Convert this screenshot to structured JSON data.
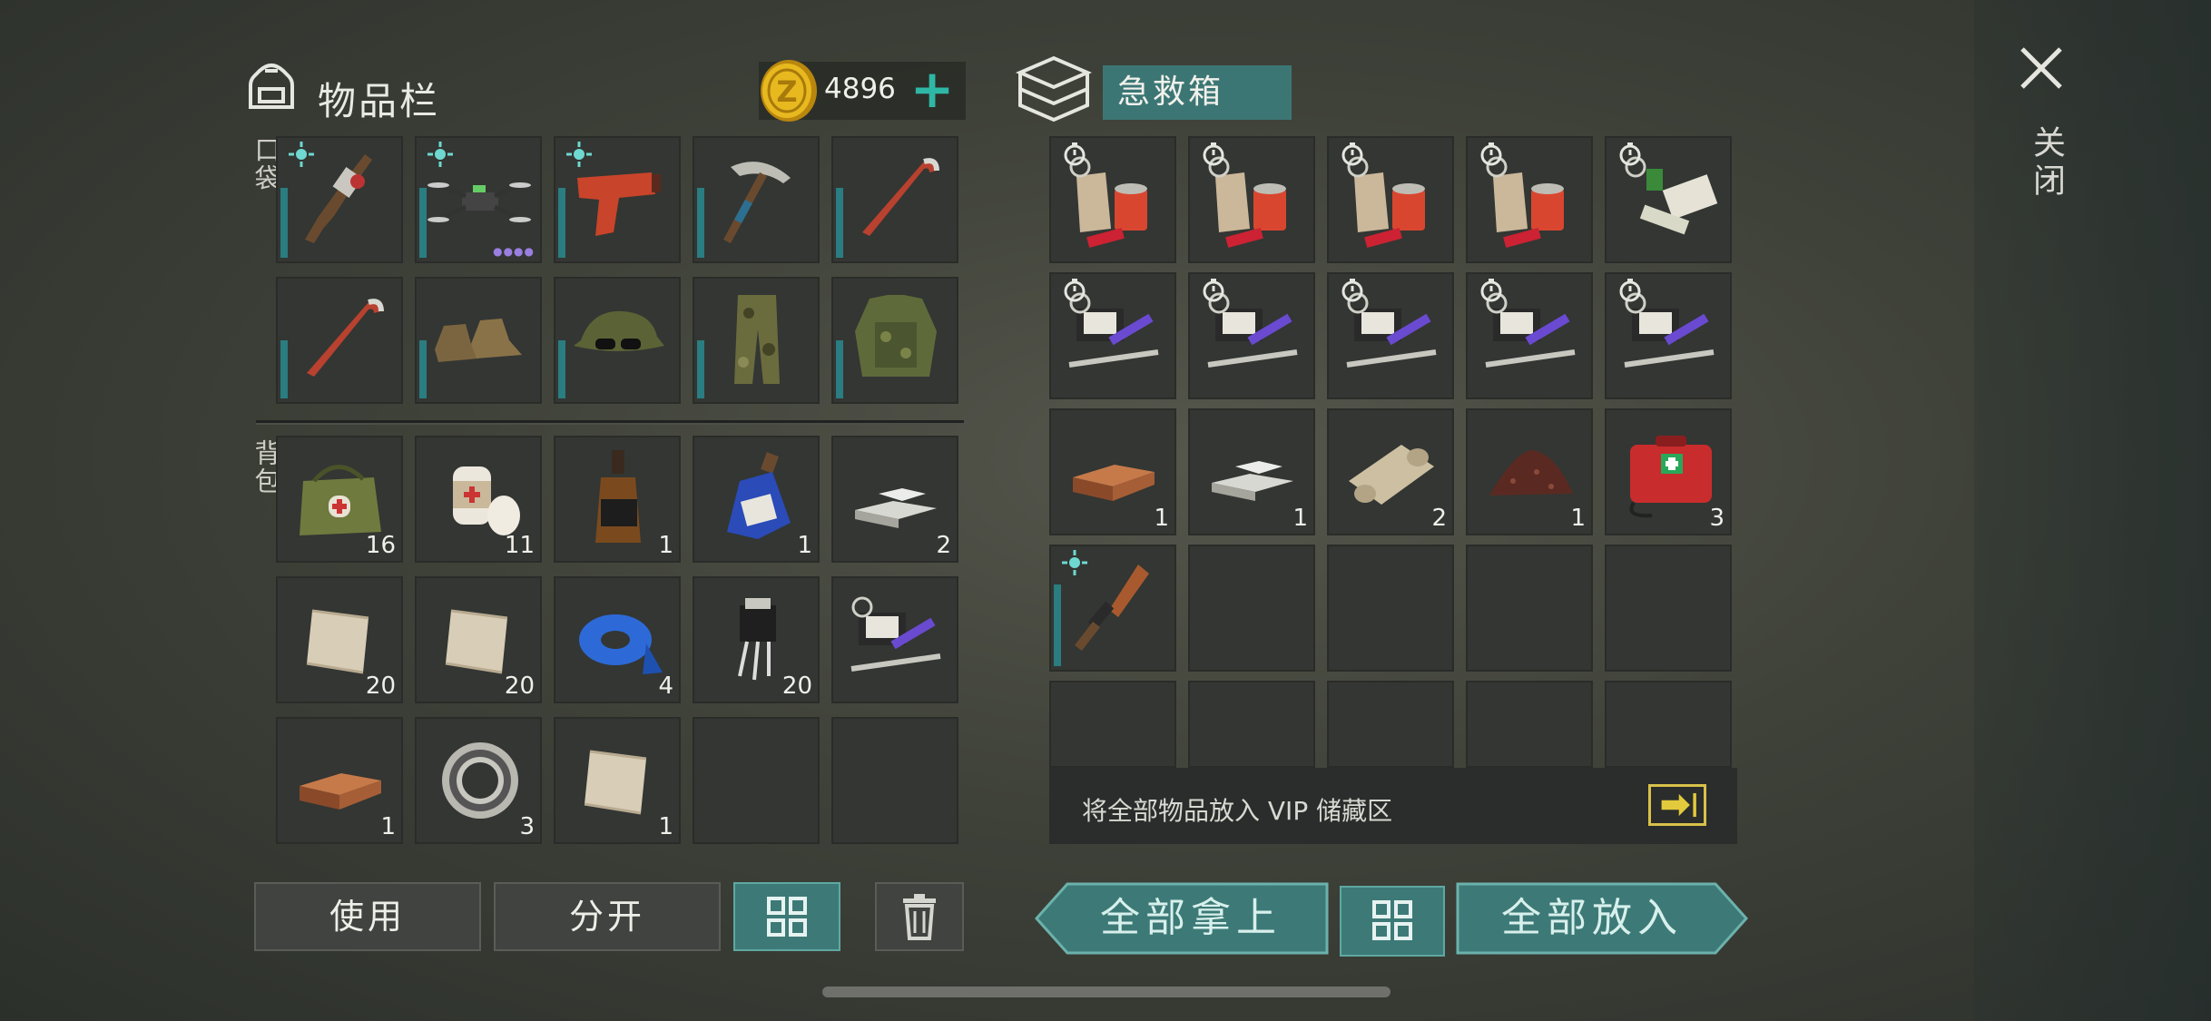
{
  "inventory": {
    "title": "物品栏",
    "coins": "4896",
    "coin_add": "+",
    "pocket_label": "口袋",
    "backpack_label": "背包",
    "pocket_slots": [
      {
        "icon": "assault-rifle-icon",
        "count": "",
        "bar": 0.6,
        "tag": true
      },
      {
        "icon": "drone-icon",
        "count": "",
        "bar": 0.6,
        "tag": true,
        "dots": "●●●●"
      },
      {
        "icon": "flare-gun-icon",
        "count": "",
        "bar": 0.6,
        "tag": true
      },
      {
        "icon": "pickaxe-icon",
        "count": "",
        "bar": 0.6,
        "tag": false
      },
      {
        "icon": "crowbar-icon",
        "count": "",
        "bar": 0.6,
        "tag": false
      },
      {
        "icon": "crowbar-icon",
        "count": "",
        "bar": 0.5,
        "tag": false
      },
      {
        "icon": "boots-icon",
        "count": "",
        "bar": 0.5,
        "tag": false
      },
      {
        "icon": "cap-glasses-icon",
        "count": "",
        "bar": 0.5,
        "tag": false
      },
      {
        "icon": "camo-pants-icon",
        "count": "",
        "bar": 0.5,
        "tag": false
      },
      {
        "icon": "body-armor-icon",
        "count": "",
        "bar": 0.5,
        "tag": false
      }
    ],
    "backpack_slots": [
      {
        "icon": "medkit-bag-icon",
        "count": "16"
      },
      {
        "icon": "bandage-icon",
        "count": "11"
      },
      {
        "icon": "whiskey-bottle-icon",
        "count": "1"
      },
      {
        "icon": "blue-bottle-icon",
        "count": "1"
      },
      {
        "icon": "iron-ingot-icon",
        "count": "2"
      },
      {
        "icon": "cloth-scrap-icon",
        "count": "20"
      },
      {
        "icon": "cloth-scrap-icon",
        "count": "20"
      },
      {
        "icon": "blue-tape-icon",
        "count": "4"
      },
      {
        "icon": "transistor-icon",
        "count": "20"
      },
      {
        "icon": "toolkit-icon",
        "count": ""
      },
      {
        "icon": "copper-ingot-icon",
        "count": "1"
      },
      {
        "icon": "bearing-icon",
        "count": "3"
      },
      {
        "icon": "cloth-scrap-icon",
        "count": "1"
      },
      {
        "icon": "",
        "count": ""
      },
      {
        "icon": "",
        "count": ""
      }
    ],
    "buttons": {
      "use": "使用",
      "split": "分开"
    }
  },
  "firstaid": {
    "title": "急救箱",
    "slots": [
      {
        "icon": "food-ration-icon",
        "count": "",
        "timer": true
      },
      {
        "icon": "food-ration-icon",
        "count": "",
        "timer": true
      },
      {
        "icon": "food-ration-icon",
        "count": "",
        "timer": true
      },
      {
        "icon": "food-ration-icon",
        "count": "",
        "timer": true
      },
      {
        "icon": "medicine-pack-icon",
        "count": "",
        "timer": true
      },
      {
        "icon": "toolkit-icon",
        "count": "",
        "timer": true
      },
      {
        "icon": "toolkit-icon",
        "count": "",
        "timer": true
      },
      {
        "icon": "toolkit-icon",
        "count": "",
        "timer": true
      },
      {
        "icon": "toolkit-icon",
        "count": "",
        "timer": true
      },
      {
        "icon": "toolkit-icon",
        "count": "",
        "timer": true
      },
      {
        "icon": "copper-ingot-icon",
        "count": "1"
      },
      {
        "icon": "iron-ingot-icon",
        "count": "1"
      },
      {
        "icon": "cloth-roll-icon",
        "count": "2"
      },
      {
        "icon": "dirt-pile-icon",
        "count": "1"
      },
      {
        "icon": "red-medkit-icon",
        "count": "3"
      },
      {
        "icon": "knife-icon",
        "count": "",
        "bar": 0.7,
        "tag": true
      },
      {
        "icon": "",
        "count": ""
      },
      {
        "icon": "",
        "count": ""
      },
      {
        "icon": "",
        "count": ""
      },
      {
        "icon": "",
        "count": ""
      }
    ],
    "vip_text": "将全部物品放入 VIP 储藏区",
    "take_all": "全部拿上",
    "put_all": "全部放入"
  },
  "close_label": "关闭",
  "colors": {
    "accent": "#3d7a77",
    "bar": "#2a7d80",
    "coin": "#e3b21c",
    "plus": "#2fb7a6"
  }
}
